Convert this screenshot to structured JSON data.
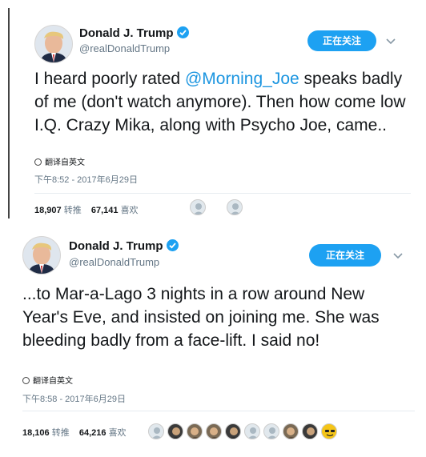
{
  "tweets": [
    {
      "name": "Donald J. Trump",
      "handle": "@realDonaldTrump",
      "follow_label": "正在关注",
      "text_before": "I heard poorly rated ",
      "mention": "@Morning_Joe",
      "text_after": " speaks badly of me (don't watch anymore). Then how come low I.Q. Crazy Mika, along with Psycho Joe, came..",
      "translate_label": "翻译自英文",
      "timestamp": "下午8:52 - 2017年6月29日",
      "retweets_count": "18,907",
      "retweets_label": "转推",
      "likes_count": "67,141",
      "likes_label": "喜欢",
      "likers": [
        "gray",
        "gray"
      ]
    },
    {
      "name": "Donald J. Trump",
      "handle": "@realDonaldTrump",
      "follow_label": "正在关注",
      "text": "...to Mar-a-Lago 3 nights in a row around New Year's Eve, and insisted on joining me. She was bleeding badly from a face-lift. I said no!",
      "translate_label": "翻译自英文",
      "timestamp": "下午8:58 - 2017年6月29日",
      "retweets_count": "18,106",
      "retweets_label": "转推",
      "likes_count": "64,216",
      "likes_label": "喜欢",
      "likers": [
        "gray",
        "dark",
        "photo",
        "photo",
        "dark",
        "gray",
        "gray",
        "photo",
        "dark",
        "emoji"
      ]
    }
  ],
  "colors": {
    "accent": "#1da1f2",
    "mention": "#1b95e0",
    "muted": "#657786"
  }
}
